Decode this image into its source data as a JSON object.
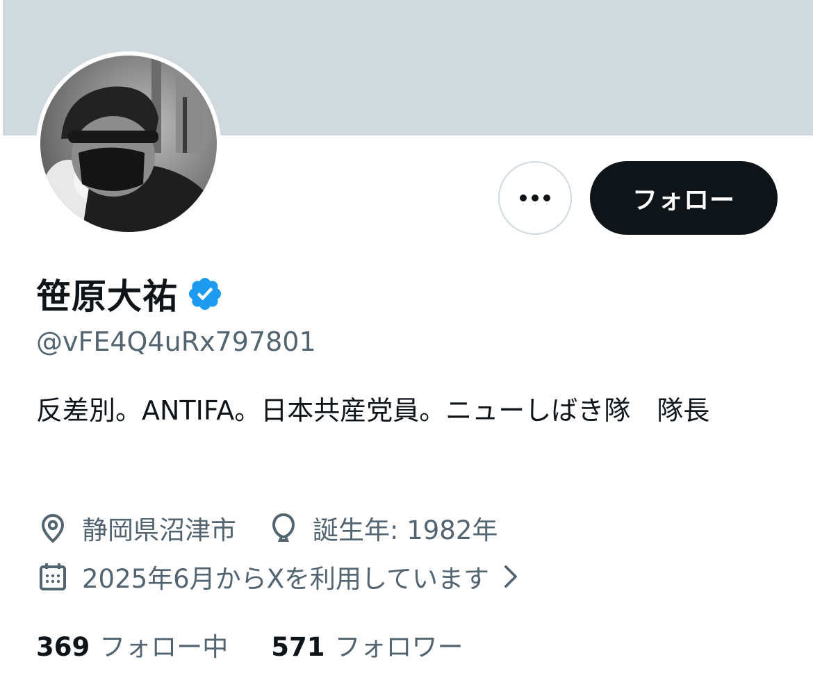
{
  "profile": {
    "display_name": "笹原大祐",
    "handle": "@vFE4Q4uRx797801",
    "bio": "反差別。ANTIFA。日本共産党員。ニューしばき隊　隊長",
    "location": "静岡県沼津市",
    "birth": "誕生年: 1982年",
    "joined": "2025年6月からXを利用しています",
    "verified": true
  },
  "actions": {
    "follow_label": "フォロー",
    "more_icon": "more-horizontal-icon"
  },
  "stats": {
    "following_count": "369",
    "following_label": "フォロー中",
    "followers_count": "571",
    "followers_label": "フォロワー"
  },
  "icons": {
    "verified": "verified-badge-icon",
    "location": "location-pin-icon",
    "birth": "balloon-icon",
    "joined": "calendar-icon",
    "chevron": "chevron-right-icon"
  },
  "colors": {
    "banner": "#cfd9de",
    "verified": "#1d9bf0",
    "primary_text": "#0f1419",
    "secondary_text": "#536471",
    "button": "#0f1419"
  }
}
